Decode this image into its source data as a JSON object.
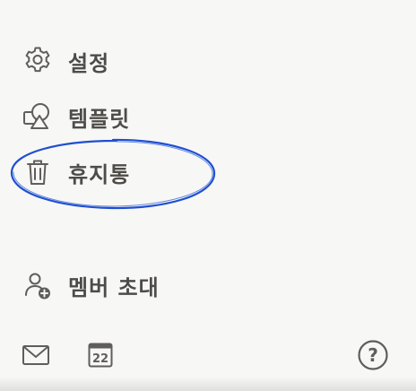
{
  "menu": {
    "settings": {
      "label": "설정",
      "icon": "gear-icon"
    },
    "templates": {
      "label": "템플릿",
      "icon": "shapes-icon"
    },
    "trash": {
      "label": "휴지통",
      "icon": "trash-icon"
    },
    "invite": {
      "label": "멤버 초대",
      "icon": "add-member-icon"
    }
  },
  "bottom_bar": {
    "mail_icon": "mail-icon",
    "calendar": {
      "icon": "calendar-icon",
      "day": "22"
    },
    "help": {
      "icon": "help-icon",
      "glyph": "?"
    }
  },
  "colors": {
    "background": "#f7f7f5",
    "text": "#4d4c48",
    "icon": "#5f5e5a",
    "annotation": "#1f4fd1"
  }
}
